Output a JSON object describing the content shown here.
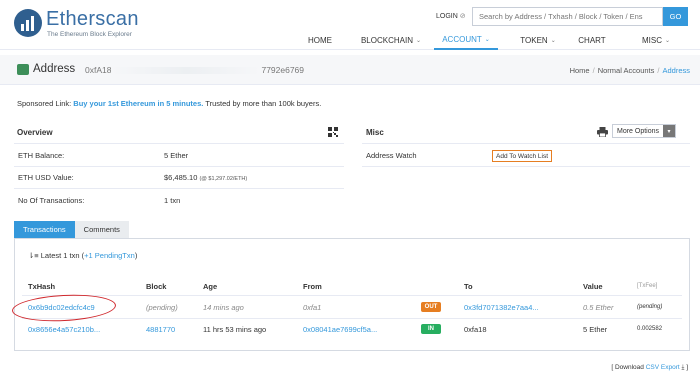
{
  "brand": {
    "name": "Etherscan",
    "tagline": "The Ethereum Block Explorer"
  },
  "header": {
    "login": "LOGIN",
    "search_placeholder": "Search by Address / Txhash / Block / Token / Ens",
    "go": "GO"
  },
  "nav": [
    {
      "label": "HOME",
      "dropdown": false,
      "active": false
    },
    {
      "label": "BLOCKCHAIN",
      "dropdown": true,
      "active": false
    },
    {
      "label": "ACCOUNT",
      "dropdown": true,
      "active": true
    },
    {
      "label": "TOKEN",
      "dropdown": true,
      "active": false
    },
    {
      "label": "CHART",
      "dropdown": false,
      "active": false
    },
    {
      "label": "MISC",
      "dropdown": true,
      "active": false
    }
  ],
  "address": {
    "title": "Address",
    "hash_start": "0xfA18",
    "hash_end": "7792e6769"
  },
  "breadcrumb": {
    "home": "Home",
    "mid": "Normal Accounts",
    "current": "Address"
  },
  "sponsored": {
    "label": "Sponsored Link:",
    "link": "Buy your 1st Ethereum in 5 minutes.",
    "text": "Trusted by more than 100k buyers."
  },
  "overview": {
    "title": "Overview",
    "rows": [
      {
        "label": "ETH Balance:",
        "value": "5 Ether",
        "sub": ""
      },
      {
        "label": "ETH USD Value:",
        "value": "$6,485.10",
        "sub": "(@ $1,297.02/ETH)"
      },
      {
        "label": "No Of Transactions:",
        "value": "1 txn",
        "sub": ""
      }
    ]
  },
  "misc": {
    "title": "Misc",
    "more_options": "More Options",
    "address_watch_label": "Address Watch",
    "watch_button": "Add To Watch List"
  },
  "tabs": {
    "transactions": "Transactions",
    "comments": "Comments"
  },
  "latest": {
    "text": "Latest 1 txn",
    "pending": "+1 PendingTxn"
  },
  "table": {
    "headers": {
      "txhash": "TxHash",
      "block": "Block",
      "age": "Age",
      "from": "From",
      "to": "To",
      "value": "Value",
      "txfee": "[TxFee]"
    },
    "rows": [
      {
        "txhash": "0x6b9dc02edcfc4c9",
        "block": "(pending)",
        "age": "14 mins ago",
        "from": "0xfa1",
        "direction": "OUT",
        "to": "0x3fd7071382e7aa4...",
        "value": "0.5 Ether",
        "fee": "(pending)"
      },
      {
        "txhash": "0x8656e4a57c210b...",
        "block": "4881770",
        "age": "11 hrs 53 mins ago",
        "from": "0x08041ae7699cf5a...",
        "direction": "IN",
        "to": "0xfa18",
        "value": "5 Ether",
        "fee": "0.002582"
      }
    ]
  },
  "csv": {
    "prefix": "[ Download",
    "link": "CSV Export",
    "suffix": "]"
  },
  "colors": {
    "accent": "#3498db",
    "out": "#e67e22",
    "in": "#27ae60",
    "annotation": "#d0282d"
  }
}
